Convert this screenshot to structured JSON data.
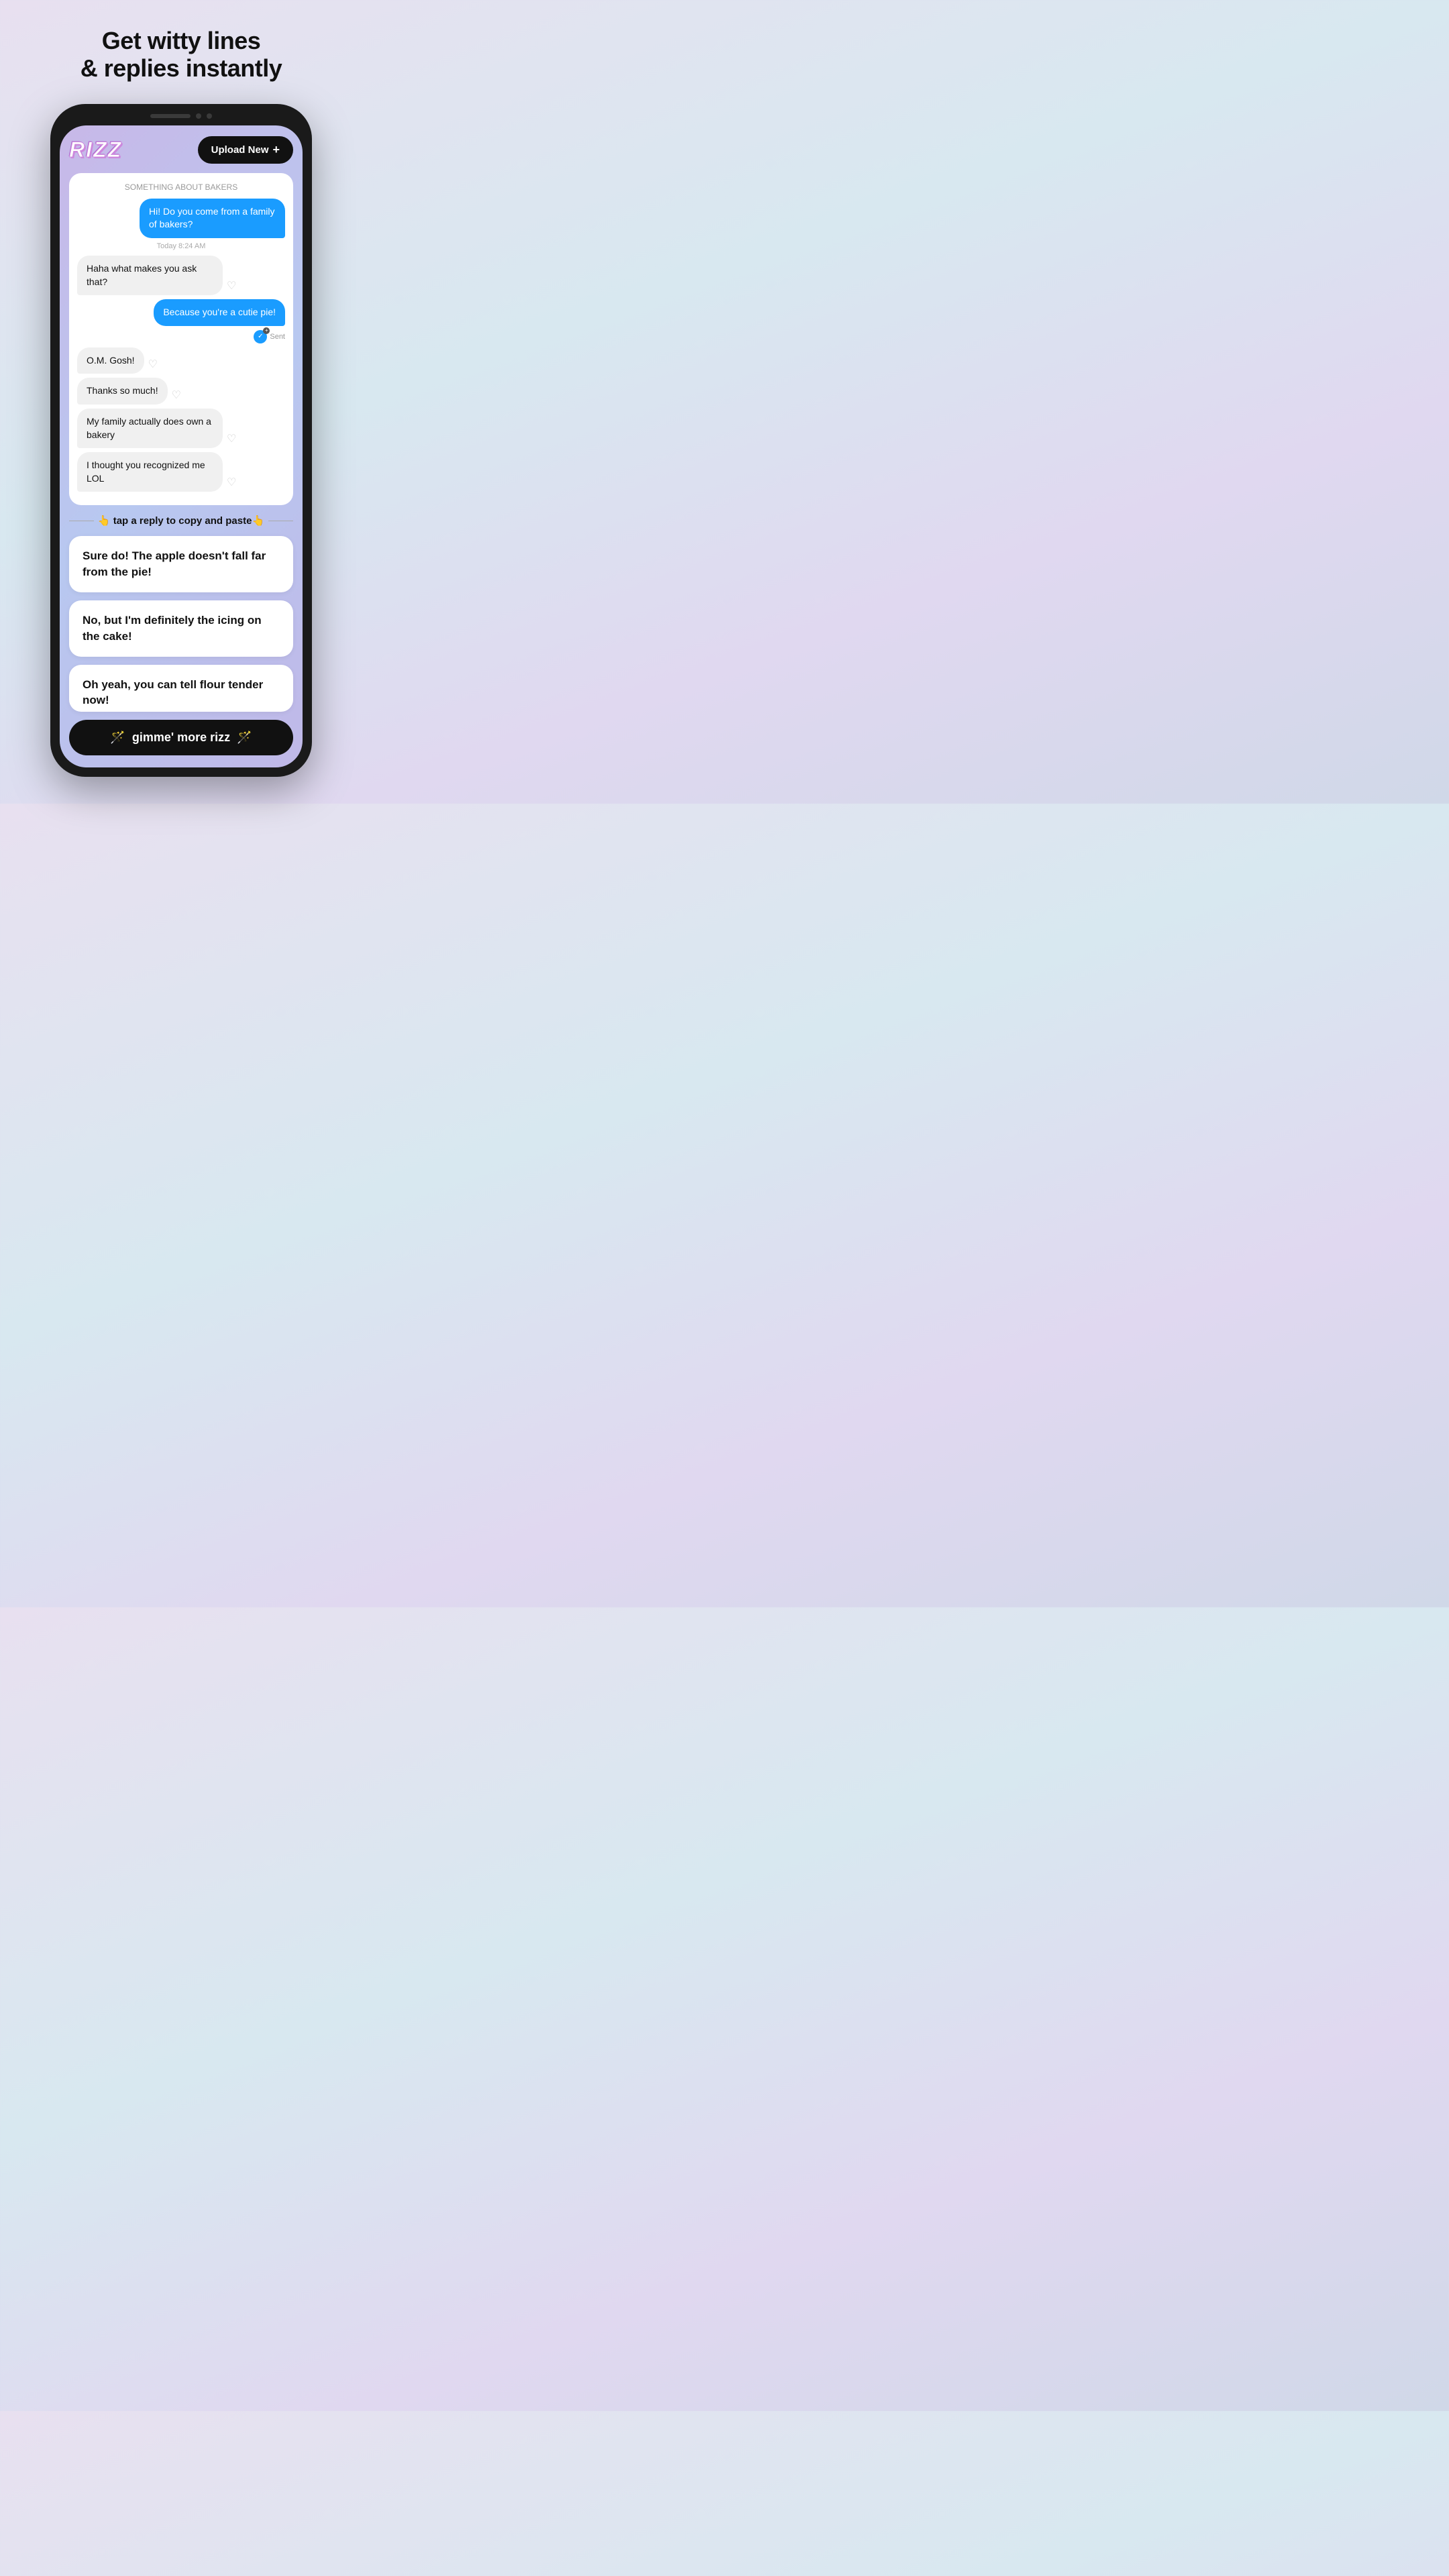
{
  "headline": {
    "line1": "Get witty lines",
    "line2": "& replies instantly"
  },
  "app": {
    "logo": "RIZZ",
    "upload_btn": "Upload New",
    "upload_plus": "+"
  },
  "chat": {
    "partial_top": "SOMETHING ABOUT BAKERS",
    "timestamp": "Today  8:24 AM",
    "messages": [
      {
        "id": "m1",
        "type": "sent",
        "text": "Hi!  Do you come from a family of bakers?"
      },
      {
        "id": "m2",
        "type": "received",
        "text": "Haha what makes you ask that?"
      },
      {
        "id": "m3",
        "type": "sent",
        "text": "Because you're a cutie pie!"
      },
      {
        "id": "m4",
        "type": "received",
        "text": "O.M. Gosh!"
      },
      {
        "id": "m5",
        "type": "received",
        "text": "Thanks so much!"
      },
      {
        "id": "m6",
        "type": "received",
        "text": "My family actually does own a bakery"
      },
      {
        "id": "m7",
        "type": "received",
        "text": "I thought you recognized me LOL"
      }
    ],
    "sent_label": "Sent"
  },
  "tap_instruction": "👆 tap a reply to copy and paste👆",
  "replies": [
    {
      "id": "r1",
      "text": "Sure do! The apple doesn't fall far from the pie!"
    },
    {
      "id": "r2",
      "text": "No, but I'm definitely the icing on the cake!"
    },
    {
      "id": "r3",
      "text": "Oh yeah, you can tell flour tender now!"
    }
  ],
  "gimme_btn": {
    "icon": "🪄",
    "label": "gimme' more rizz"
  }
}
